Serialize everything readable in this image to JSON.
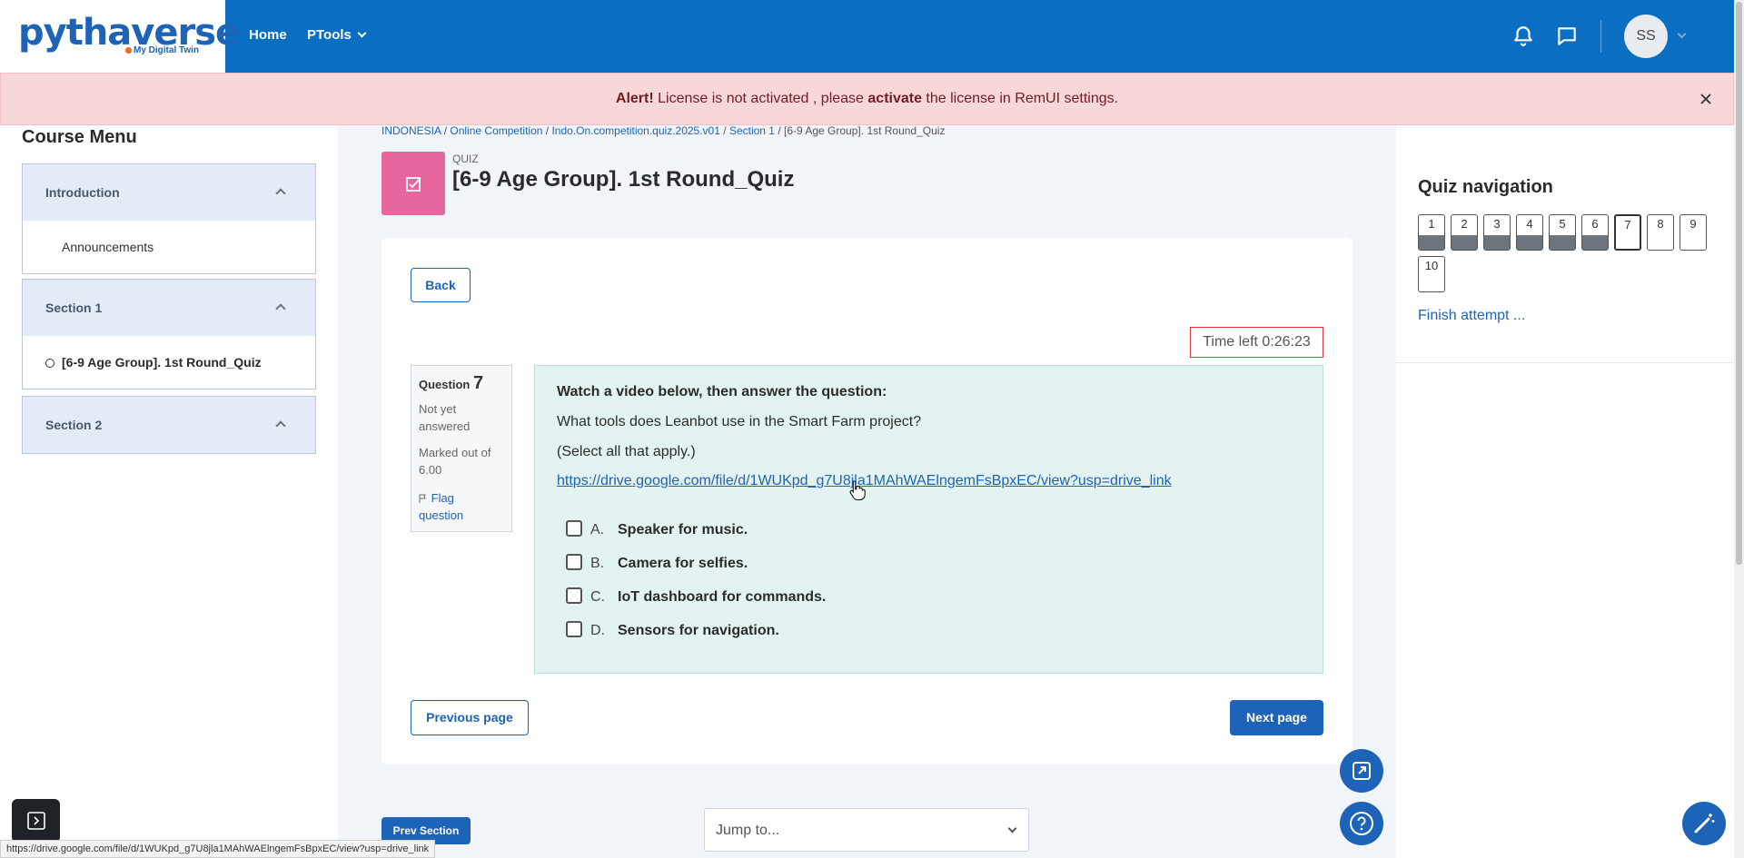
{
  "brand": {
    "logo_text": "pythaverse",
    "tagline": "My Digital Twin"
  },
  "nav": {
    "home": "Home",
    "ptools": "PTools",
    "avatar_initials": "SS"
  },
  "alert": {
    "prefix": "Alert!",
    "text_before": " License is not activated , please ",
    "bold_word": "activate",
    "text_after": " the license in RemUI settings."
  },
  "course_menu": {
    "title": "Course Menu",
    "sections": [
      {
        "title": "Introduction",
        "items": [
          "Announcements"
        ]
      },
      {
        "title": "Section 1",
        "items": [
          "[6-9 Age Group]. 1st Round_Quiz"
        ]
      },
      {
        "title": "Section 2",
        "items": []
      }
    ]
  },
  "breadcrumb": [
    "INDONESIA",
    "Online Competition",
    "Indo.On.competition.quiz.2025.v01",
    "Section 1",
    "[6-9 Age Group]. 1st Round_Quiz"
  ],
  "quiz": {
    "label": "QUIZ",
    "title": "[6-9 Age Group]. 1st Round_Quiz",
    "back": "Back",
    "time_left": "Time left 0:26:23"
  },
  "question": {
    "word": "Question",
    "number": "7",
    "status": [
      "Not yet",
      "answered"
    ],
    "marked": [
      "Marked out of",
      "6.00"
    ],
    "flag": [
      "Flag",
      "question"
    ],
    "heading": "Watch a video below, then answer the question:",
    "text": "What tools does Leanbot use in the Smart Farm project?",
    "hint": "(Select all that apply.)",
    "link": "https://drive.google.com/file/d/1WUKpd_g7U8jla1MAhWAElngemFsBpxEC/view?usp=drive_link",
    "answers": [
      {
        "letter": "A.",
        "text": "Speaker for music."
      },
      {
        "letter": "B.",
        "text": "Camera for selfies."
      },
      {
        "letter": "C.",
        "text": "IoT dashboard for commands."
      },
      {
        "letter": "D.",
        "text": "Sensors for navigation."
      }
    ]
  },
  "pager": {
    "previous": "Previous page",
    "next": "Next page",
    "prev_section": "Prev Section",
    "jump": "Jump to..."
  },
  "quiz_nav": {
    "title": "Quiz navigation",
    "buttons": [
      "1",
      "2",
      "3",
      "4",
      "5",
      "6",
      "7",
      "8",
      "9",
      "10"
    ],
    "finish": "Finish attempt ..."
  },
  "status_bar_url": "https://drive.google.com/file/d/1WUKpd_g7U8jla1MAhWAElngemFsBpxEC/view?usp=drive_link",
  "colors": {
    "primary": "#1d63b7",
    "navbar": "#0a6fc2",
    "quiz_icon": "#e8669e",
    "alert_bg": "#f7d7da"
  }
}
